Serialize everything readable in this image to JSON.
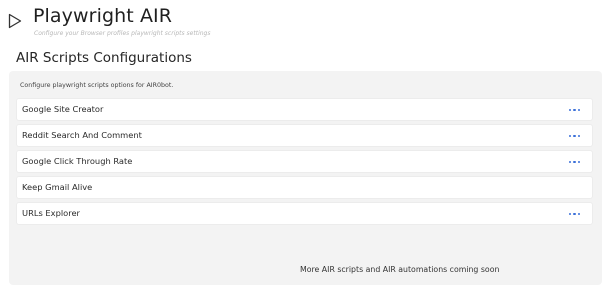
{
  "header": {
    "icon": "play-outline-icon",
    "title": "Playwright AIR",
    "subtitle": "Configure your Browser profiles playwright scripts settings"
  },
  "section": {
    "title": "AIR Scripts Configurations",
    "description": "Configure playwright scripts options for AIR0bot."
  },
  "scripts": [
    {
      "label": "Google Site Creator",
      "has_menu": true
    },
    {
      "label": "Reddit Search And Comment",
      "has_menu": true
    },
    {
      "label": "Google Click Through Rate",
      "has_menu": true
    },
    {
      "label": "Keep Gmail Alive",
      "has_menu": false
    },
    {
      "label": "URLs Explorer",
      "has_menu": true
    }
  ],
  "footer": {
    "note": "More AIR scripts and AIR automations coming soon"
  },
  "colors": {
    "accent": "#3a6fd8",
    "panel_bg": "#f3f3f3"
  }
}
